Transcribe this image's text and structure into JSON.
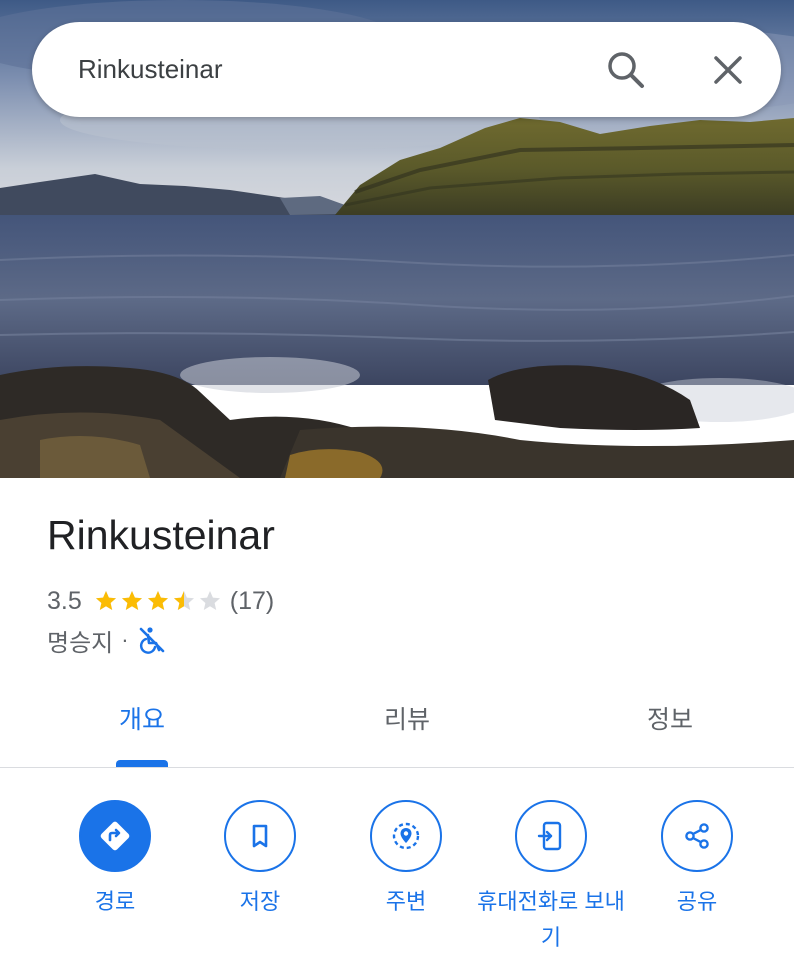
{
  "search": {
    "value": "Rinkusteinar"
  },
  "place": {
    "title": "Rinkusteinar",
    "rating": "3.5",
    "rating_stars": 3.5,
    "rating_max": 5,
    "review_count": "(17)",
    "category": "명승지",
    "separator": "·"
  },
  "tabs": [
    {
      "label": "개요",
      "active": true
    },
    {
      "label": "리뷰",
      "active": false
    },
    {
      "label": "정보",
      "active": false
    }
  ],
  "actions": [
    {
      "label": "경로",
      "icon": "directions-icon"
    },
    {
      "label": "저장",
      "icon": "bookmark-icon"
    },
    {
      "label": "주변",
      "icon": "nearby-icon"
    },
    {
      "label": "휴대전화로 보내기",
      "icon": "send-to-phone-icon"
    },
    {
      "label": "공유",
      "icon": "share-icon"
    }
  ],
  "colors": {
    "accent": "#1a73e8",
    "star": "#fbbc04",
    "star_empty": "#dadce0",
    "text_secondary": "#5f6368"
  }
}
